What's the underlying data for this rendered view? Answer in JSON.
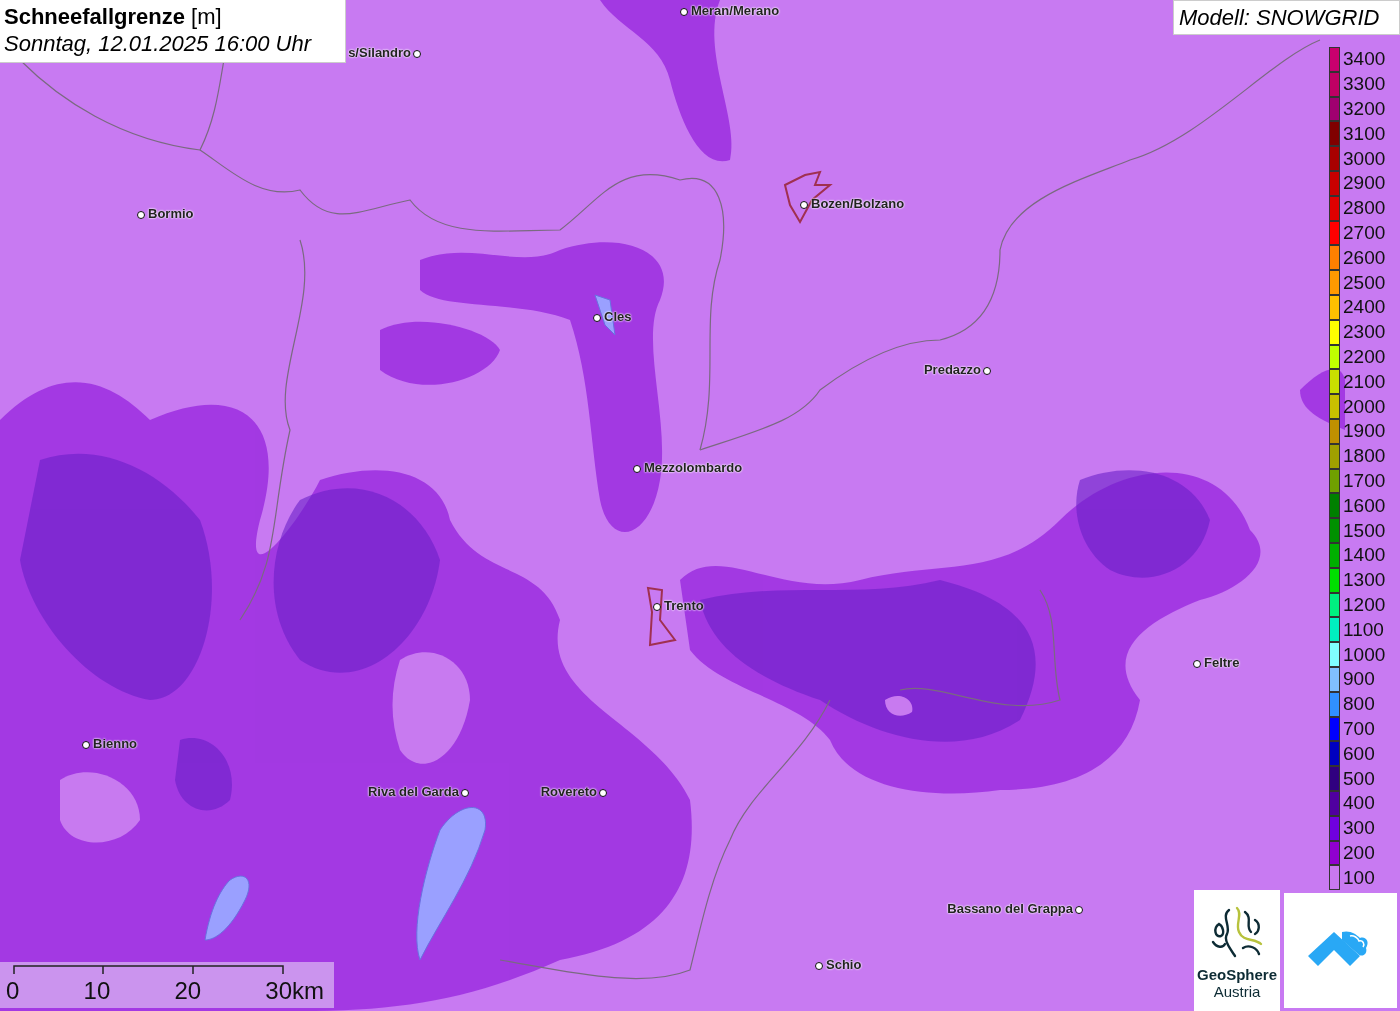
{
  "title": {
    "parameter": "Schneefallgrenze",
    "unit": "[m]",
    "datetime": "Sonntag, 12.01.2025 16:00 Uhr"
  },
  "model_label": "Modell: SNOWGRID",
  "places": [
    {
      "name": "Meran/Merano"
    },
    {
      "name": "s/Silandro"
    },
    {
      "name": "Bormio"
    },
    {
      "name": "Bozen/Bolzano"
    },
    {
      "name": "Cles"
    },
    {
      "name": "Predazzo"
    },
    {
      "name": "Mezzolombardo"
    },
    {
      "name": "Trento"
    },
    {
      "name": "Feltre"
    },
    {
      "name": "Bienno"
    },
    {
      "name": "Riva del Garda"
    },
    {
      "name": "Rovereto"
    },
    {
      "name": "Bassano del Grappa"
    },
    {
      "name": "Schio"
    }
  ],
  "legend": [
    {
      "label": "3400",
      "color": "#c8006e"
    },
    {
      "label": "3300",
      "color": "#c00064"
    },
    {
      "label": "3200",
      "color": "#a00070"
    },
    {
      "label": "3100",
      "color": "#800000"
    },
    {
      "label": "3000",
      "color": "#a80000"
    },
    {
      "label": "2900",
      "color": "#c80000"
    },
    {
      "label": "2800",
      "color": "#e00000"
    },
    {
      "label": "2700",
      "color": "#ff0000"
    },
    {
      "label": "2600",
      "color": "#ff8000"
    },
    {
      "label": "2500",
      "color": "#ff9a00"
    },
    {
      "label": "2400",
      "color": "#ffc000"
    },
    {
      "label": "2300",
      "color": "#ffff00"
    },
    {
      "label": "2200",
      "color": "#c0ff00"
    },
    {
      "label": "2100",
      "color": "#c8e000"
    },
    {
      "label": "2000",
      "color": "#c8c000"
    },
    {
      "label": "1900",
      "color": "#c09000"
    },
    {
      "label": "1800",
      "color": "#a0a000"
    },
    {
      "label": "1700",
      "color": "#70a000"
    },
    {
      "label": "1600",
      "color": "#008000"
    },
    {
      "label": "1500",
      "color": "#009000"
    },
    {
      "label": "1400",
      "color": "#00b000"
    },
    {
      "label": "1300",
      "color": "#00e000"
    },
    {
      "label": "1200",
      "color": "#00f080"
    },
    {
      "label": "1100",
      "color": "#00f0c0"
    },
    {
      "label": "1000",
      "color": "#80ffff"
    },
    {
      "label": "900",
      "color": "#80c0ff"
    },
    {
      "label": "800",
      "color": "#3090ff"
    },
    {
      "label": "700",
      "color": "#0000ff"
    },
    {
      "label": "600",
      "color": "#0000c0"
    },
    {
      "label": "500",
      "color": "#300080"
    },
    {
      "label": "400",
      "color": "#5000a0"
    },
    {
      "label": "300",
      "color": "#7000e0"
    },
    {
      "label": "200",
      "color": "#9000d0"
    },
    {
      "label": "100",
      "color": "#c878f0"
    }
  ],
  "scale_bar": {
    "ticks": [
      "0",
      "10",
      "20",
      "30km"
    ]
  },
  "logos": {
    "geosphere_name": "GeoSphere",
    "geosphere_country": "Austria"
  }
}
